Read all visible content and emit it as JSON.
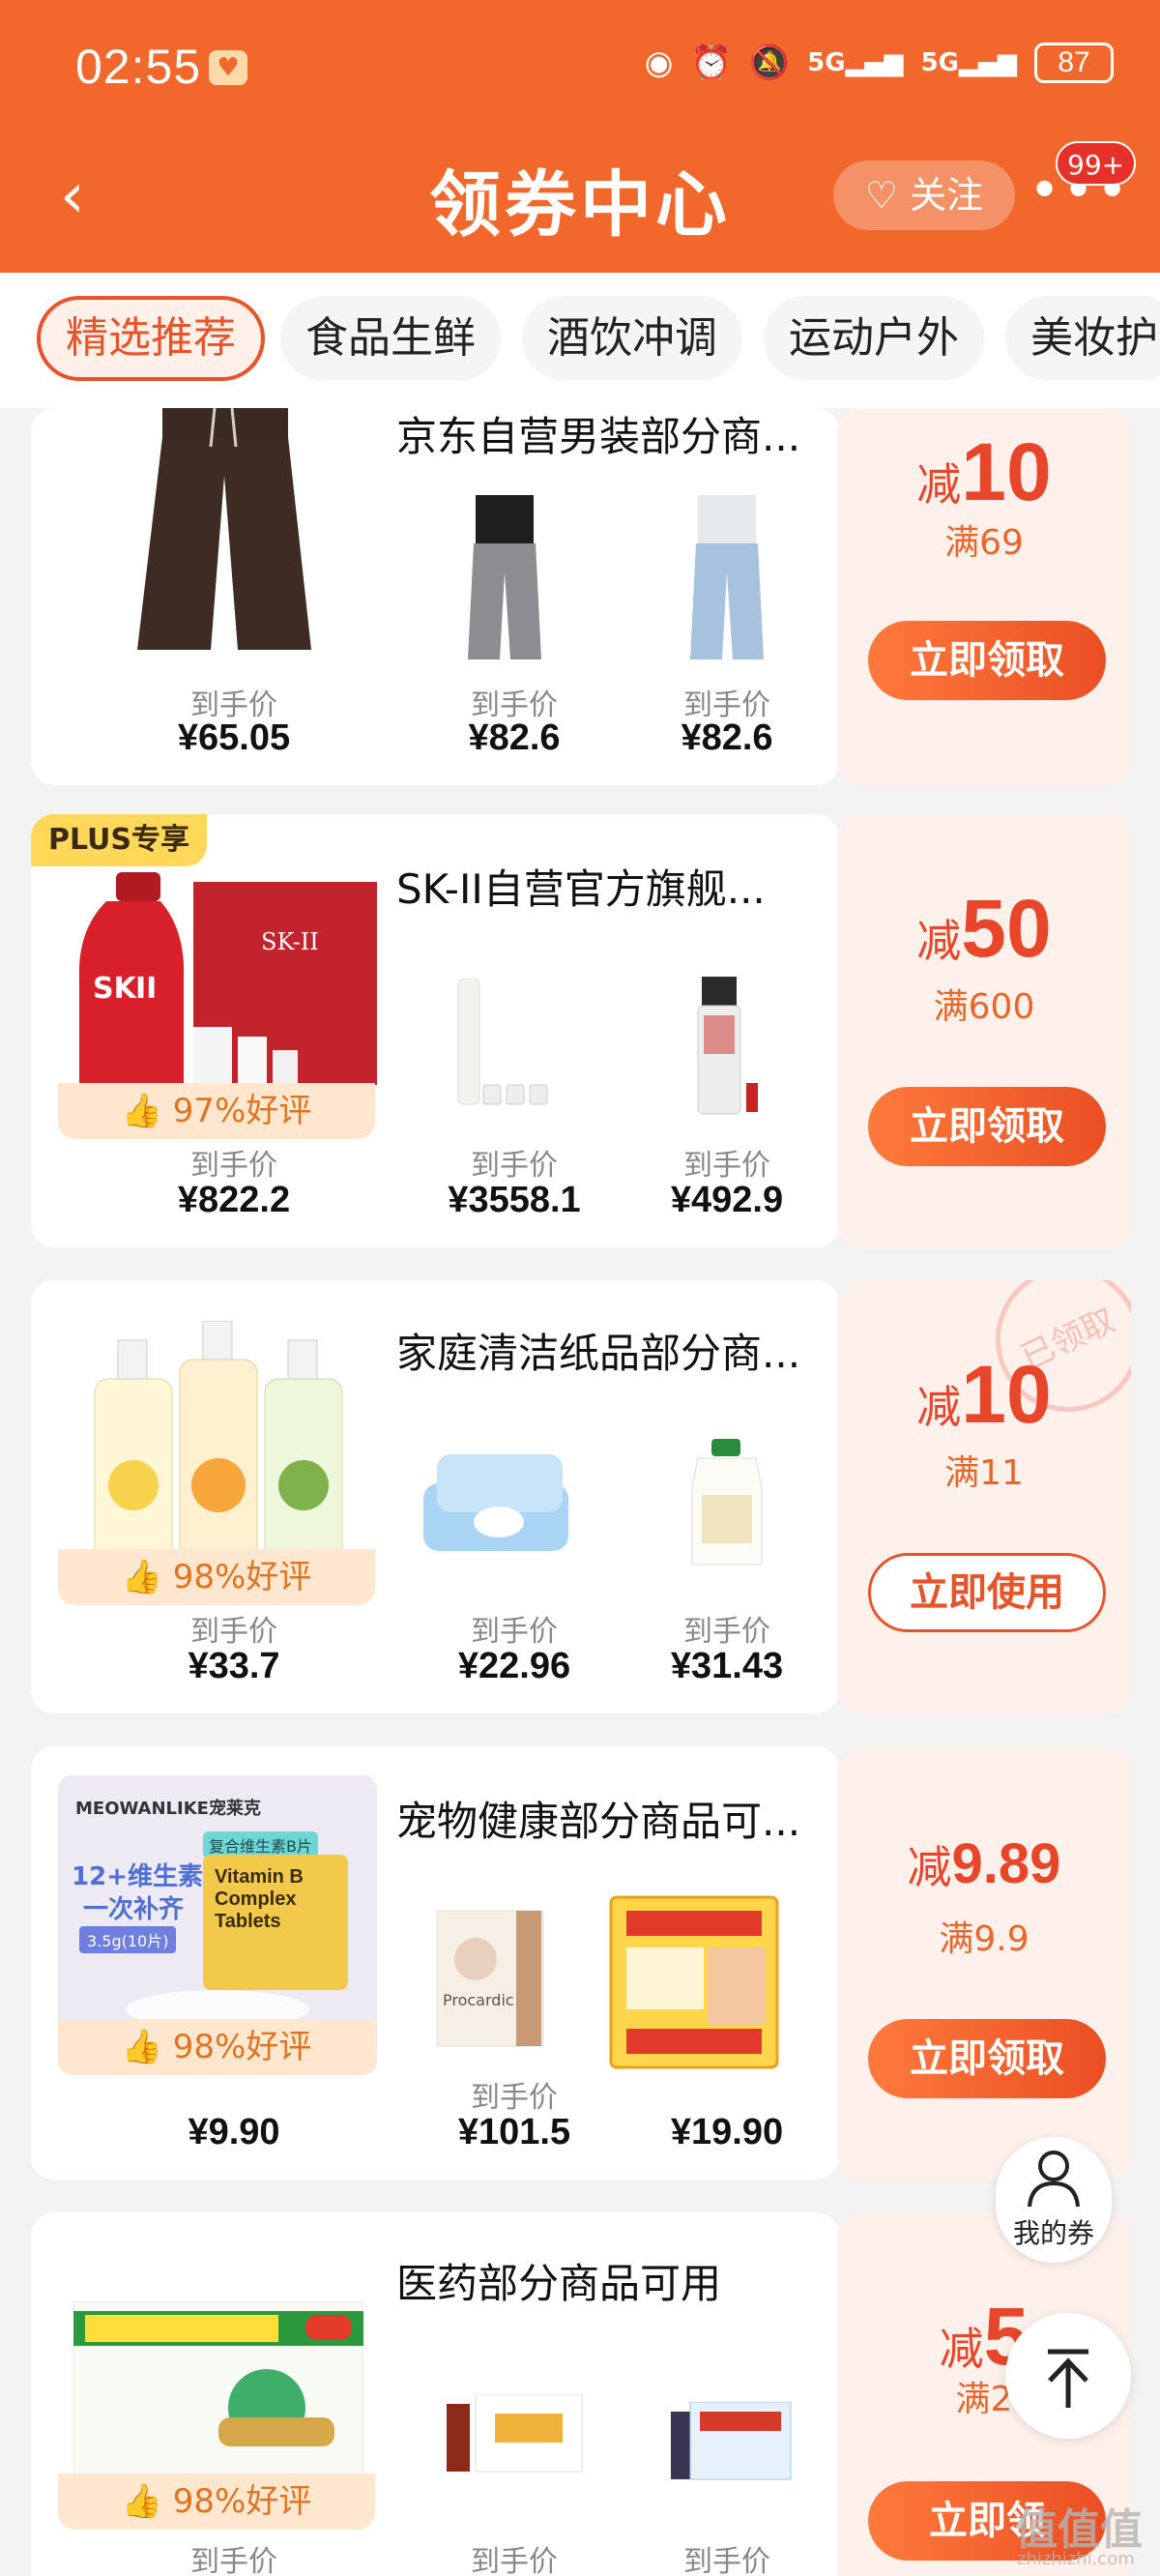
{
  "status": {
    "time": "02:55",
    "battery": "87",
    "signal1": "5G",
    "signal2": "5G"
  },
  "header": {
    "title": "领券中心",
    "follow_label": "关注",
    "more_badge": "99+"
  },
  "tabs": [
    "精选推荐",
    "食品生鲜",
    "酒饮冲调",
    "运动户外",
    "美妆护"
  ],
  "cards": [
    {
      "shop": "京东自营男装部分商...",
      "prices": [
        {
          "label": "到手价",
          "price": "¥65.05"
        },
        {
          "label": "到手价",
          "price": "¥82.6"
        },
        {
          "label": "到手价",
          "price": "¥82.6"
        }
      ],
      "coupon": {
        "prefix": "减",
        "amount": "10",
        "condition": "满69",
        "button": "立即领取"
      }
    },
    {
      "tag": "PLUS专享",
      "shop": "SK-II自营官方旗舰...",
      "rating": "97%好评",
      "prices": [
        {
          "label": "到手价",
          "price": "¥822.2"
        },
        {
          "label": "到手价",
          "price": "¥3558.1"
        },
        {
          "label": "到手价",
          "price": "¥492.9"
        }
      ],
      "coupon": {
        "prefix": "减",
        "amount": "50",
        "condition": "满600",
        "button": "立即领取"
      }
    },
    {
      "shop": "家庭清洁纸品部分商...",
      "rating": "98%好评",
      "prices": [
        {
          "label": "到手价",
          "price": "¥33.7"
        },
        {
          "label": "到手价",
          "price": "¥22.96"
        },
        {
          "label": "到手价",
          "price": "¥31.43"
        }
      ],
      "coupon": {
        "prefix": "减",
        "amount": "10",
        "condition": "满11",
        "button": "立即使用",
        "stamp": "已领取"
      }
    },
    {
      "shop": "宠物健康部分商品可...",
      "rating": "98%好评",
      "prices": [
        {
          "label": "",
          "price": "¥9.90"
        },
        {
          "label": "到手价",
          "price": "¥101.5"
        },
        {
          "label": "",
          "price": "¥19.90"
        }
      ],
      "coupon": {
        "prefix": "减",
        "amount": "9.89",
        "condition": "满9.9",
        "button": "立即领取"
      },
      "product_text": {
        "brand": "MEOWANLIKE宠莱克",
        "tagline1": "12+维生素",
        "tagline2": "一次补齐",
        "pack": "3.5g(10片)",
        "box": "Vitamin B Complex Tablets",
        "sticker": "复合维生素B片",
        "p2": "Procardic"
      }
    },
    {
      "shop": "医药部分商品可用",
      "rating": "98%好评",
      "prices": [
        {
          "label": "到手价",
          "price": ""
        },
        {
          "label": "到手价",
          "price": ""
        },
        {
          "label": "到手价",
          "price": ""
        }
      ],
      "coupon": {
        "prefix": "减",
        "amount": "5",
        "condition": "满2",
        "button": "立即领"
      }
    }
  ],
  "float": {
    "my_coupon": "我的券"
  },
  "watermark": {
    "text": "值值值",
    "url": "zhizhizhi.com"
  }
}
